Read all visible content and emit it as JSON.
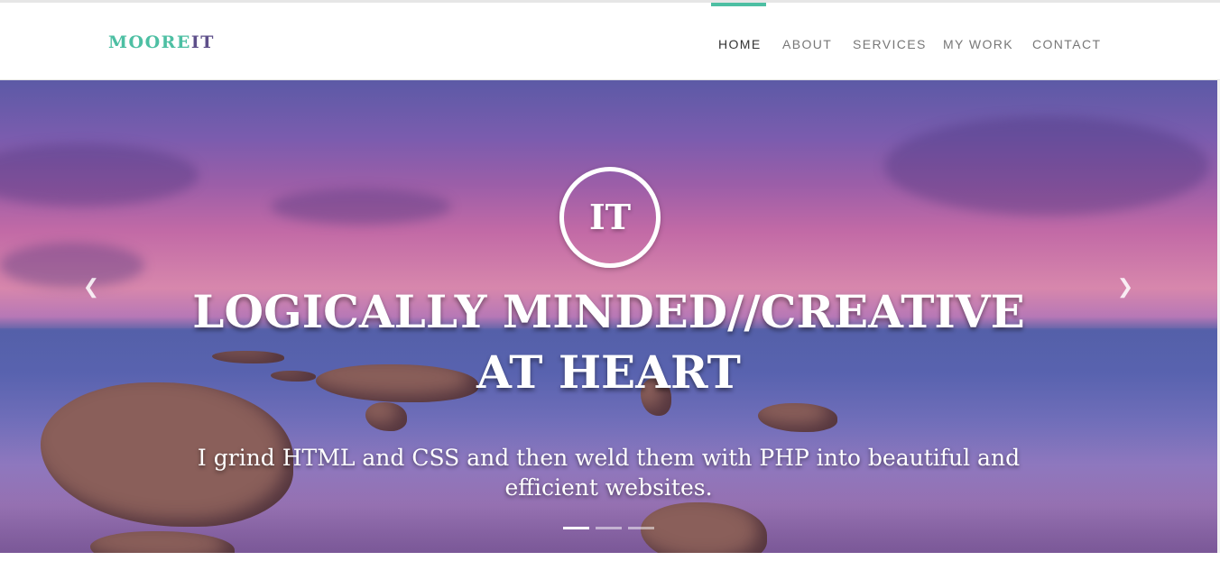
{
  "brand": {
    "part1": "MOORE",
    "part2": "IT"
  },
  "nav": {
    "items": [
      {
        "label": "HOME",
        "active": true
      },
      {
        "label": "ABOUT",
        "active": false
      },
      {
        "label": "SERVICES",
        "active": false
      },
      {
        "label": "MY WORK",
        "active": false
      },
      {
        "label": "CONTACT",
        "active": false
      }
    ]
  },
  "hero": {
    "logo_text": "IT",
    "headline_line1": "LOGICALLY MINDED//CREATIVE",
    "headline_line2": "AT HEART",
    "subtitle": "I grind HTML and CSS and then weld them with PHP into beautiful and efficient websites.",
    "prev_icon": "chevron-left-icon",
    "next_icon": "chevron-right-icon",
    "slides": {
      "count": 3,
      "active": 1
    }
  },
  "colors": {
    "accent": "#4dbfa3",
    "brand_secondary": "#5e4f8a",
    "nav_text": "#777777",
    "nav_active": "#333333"
  }
}
